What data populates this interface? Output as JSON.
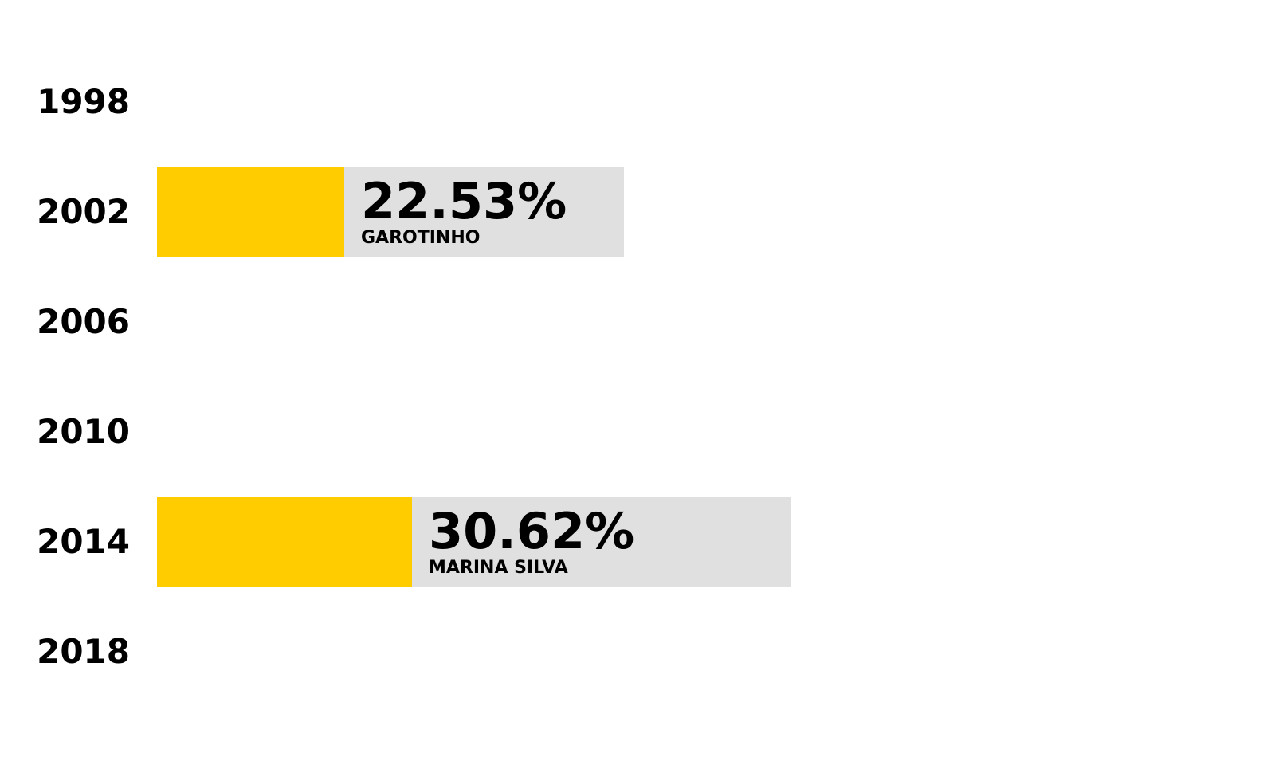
{
  "colors": {
    "highlight": "#ffcc00",
    "bar_background": "#e0e0e0",
    "text": "#000000"
  },
  "chart_data": {
    "type": "bar",
    "orientation": "horizontal",
    "categories": [
      "1998",
      "2002",
      "2006",
      "2010",
      "2014",
      "2018"
    ],
    "values": [
      null,
      22.53,
      null,
      null,
      30.62,
      null
    ],
    "value_labels": [
      "",
      "22.53%",
      "",
      "",
      "30.62%",
      ""
    ],
    "bar_names": [
      "",
      "GAROTINHO",
      "",
      "",
      "MARINA SILVA",
      ""
    ],
    "xlim": [
      0,
      100
    ],
    "grid": false,
    "legend": "none"
  }
}
